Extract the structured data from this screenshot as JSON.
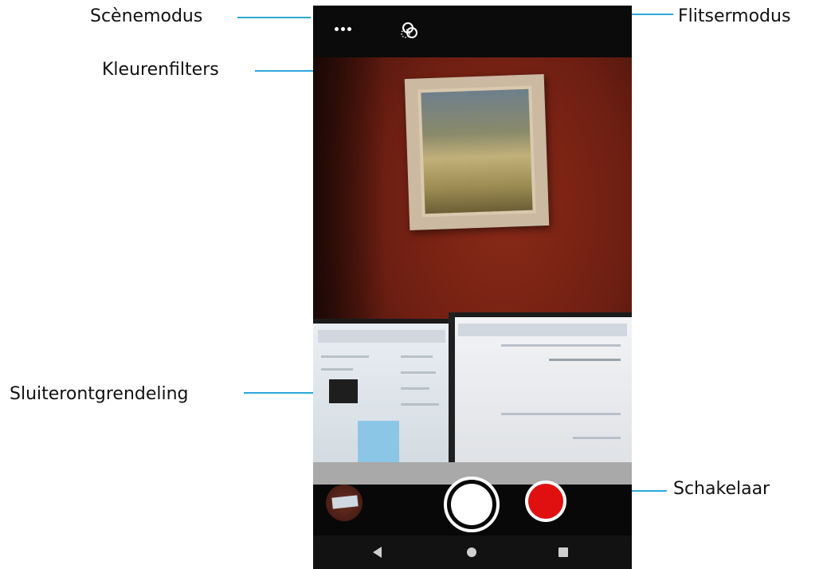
{
  "callouts": {
    "scene_mode": "Scènemodus",
    "color_filters": "Kleurenfilters",
    "flash_mode": "Flitsermodus",
    "shutter_release": "Sluiterontgrendeling",
    "switch": "Schakelaar"
  },
  "colors": {
    "callout_line": "#2ea8dc",
    "record_button": "#e01010"
  },
  "icons": {
    "more": "more-dots-icon",
    "filter": "color-filter-icon",
    "back": "nav-back-icon",
    "home": "nav-home-icon",
    "recents": "nav-recents-icon"
  }
}
